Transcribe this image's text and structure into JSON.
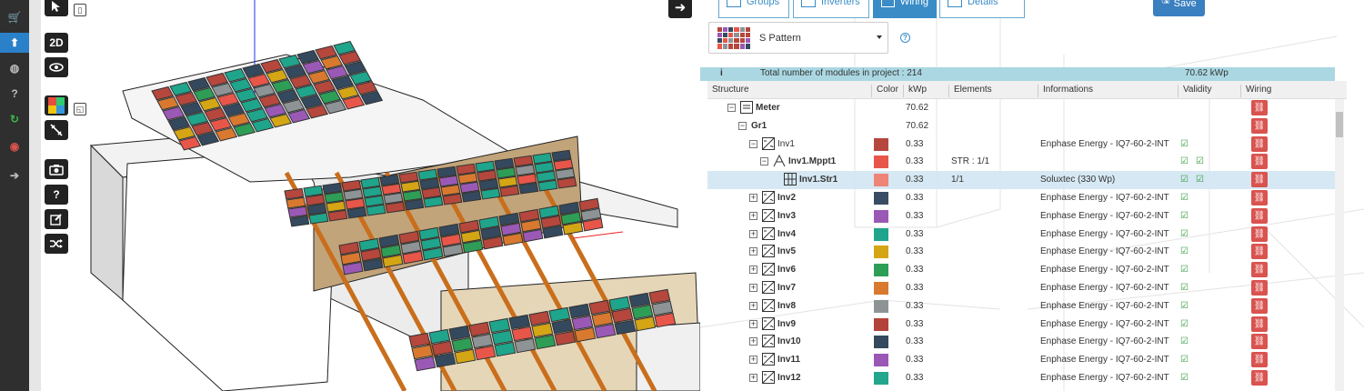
{
  "sidebar": {
    "icons": [
      "cart-icon",
      "upload-icon",
      "globe-icon",
      "help-icon",
      "refresh-icon",
      "sketchup-icon",
      "arrow-right-circle-icon"
    ],
    "active_index": 1
  },
  "viewport": {
    "toolbar": {
      "mode_2d_label": "2D",
      "help_label": "?"
    }
  },
  "panel": {
    "tabs": [
      {
        "label": "Groups",
        "icon": "groups-icon",
        "active": false
      },
      {
        "label": "Inverters",
        "icon": "inverter-icon",
        "active": false
      },
      {
        "label": "Wiring",
        "icon": "wiring-icon",
        "active": true
      },
      {
        "label": "Details",
        "icon": "chart-icon",
        "active": false
      }
    ],
    "save_label": "Save",
    "pattern": {
      "selected": "S Pattern"
    },
    "info": {
      "icon": "i",
      "text": "Total number of modules in project : 214",
      "total_kwp": "70.62 kWp"
    },
    "columns": [
      "Structure",
      "Color",
      "kWp",
      "Elements",
      "Informations",
      "Validity",
      "Wiring"
    ],
    "rows": [
      {
        "level": 1,
        "expander": "⊟",
        "icon": "meter",
        "name": "Meter",
        "color": "",
        "kwp": "70.62",
        "elements": "",
        "info": "",
        "valid": 0,
        "wiring": true,
        "bold": true
      },
      {
        "level": 2,
        "expander": "⊟",
        "icon": "",
        "name": "Gr1",
        "color": "",
        "kwp": "70.62",
        "elements": "",
        "info": "",
        "valid": 0,
        "wiring": true,
        "bold": true
      },
      {
        "level": 3,
        "expander": "⊟",
        "icon": "inverter",
        "name": "Inv1",
        "color": "#b5473d",
        "kwp": "0.33",
        "elements": "",
        "info": "Enphase Energy - IQ7-60-2-INT",
        "valid": 1,
        "wiring": true,
        "bold": false
      },
      {
        "level": 4,
        "expander": "⊟",
        "icon": "mppt",
        "name": "Inv1.Mppt1",
        "color": "#e8564a",
        "kwp": "0.33",
        "elements": "STR : 1/1",
        "info": "",
        "valid": 2,
        "wiring": true,
        "bold": true
      },
      {
        "level": 5,
        "expander": "",
        "icon": "string",
        "name": "Inv1.Str1",
        "color": "#ee8577",
        "kwp": "0.33",
        "elements": "1/1",
        "info": "Soluxtec (330 Wp)",
        "valid": 2,
        "wiring": true,
        "bold": true,
        "selected": true
      },
      {
        "level": 3,
        "expander": "⊞",
        "icon": "inverter",
        "name": "Inv2",
        "color": "#3a4c63",
        "kwp": "0.33",
        "elements": "",
        "info": "Enphase Energy - IQ7-60-2-INT",
        "valid": 1,
        "wiring": true,
        "bold": true
      },
      {
        "level": 3,
        "expander": "⊞",
        "icon": "inverter",
        "name": "Inv3",
        "color": "#9b59b6",
        "kwp": "0.33",
        "elements": "",
        "info": "Enphase Energy - IQ7-60-2-INT",
        "valid": 1,
        "wiring": true,
        "bold": true
      },
      {
        "level": 3,
        "expander": "⊞",
        "icon": "inverter",
        "name": "Inv4",
        "color": "#1fa58c",
        "kwp": "0.33",
        "elements": "",
        "info": "Enphase Energy - IQ7-60-2-INT",
        "valid": 1,
        "wiring": true,
        "bold": true
      },
      {
        "level": 3,
        "expander": "⊞",
        "icon": "inverter",
        "name": "Inv5",
        "color": "#d4a515",
        "kwp": "0.33",
        "elements": "",
        "info": "Enphase Energy - IQ7-60-2-INT",
        "valid": 1,
        "wiring": true,
        "bold": true
      },
      {
        "level": 3,
        "expander": "⊞",
        "icon": "inverter",
        "name": "Inv6",
        "color": "#2e9e57",
        "kwp": "0.33",
        "elements": "",
        "info": "Enphase Energy - IQ7-60-2-INT",
        "valid": 1,
        "wiring": true,
        "bold": true
      },
      {
        "level": 3,
        "expander": "⊞",
        "icon": "inverter",
        "name": "Inv7",
        "color": "#d8792f",
        "kwp": "0.33",
        "elements": "",
        "info": "Enphase Energy - IQ7-60-2-INT",
        "valid": 1,
        "wiring": true,
        "bold": true
      },
      {
        "level": 3,
        "expander": "⊞",
        "icon": "inverter",
        "name": "Inv8",
        "color": "#8e9496",
        "kwp": "0.33",
        "elements": "",
        "info": "Enphase Energy - IQ7-60-2-INT",
        "valid": 1,
        "wiring": true,
        "bold": true
      },
      {
        "level": 3,
        "expander": "⊞",
        "icon": "inverter",
        "name": "Inv9",
        "color": "#b3433a",
        "kwp": "0.33",
        "elements": "",
        "info": "Enphase Energy - IQ7-60-2-INT",
        "valid": 1,
        "wiring": true,
        "bold": true
      },
      {
        "level": 3,
        "expander": "⊞",
        "icon": "inverter",
        "name": "Inv10",
        "color": "#34495e",
        "kwp": "0.33",
        "elements": "",
        "info": "Enphase Energy - IQ7-60-2-INT",
        "valid": 1,
        "wiring": true,
        "bold": true
      },
      {
        "level": 3,
        "expander": "⊞",
        "icon": "inverter",
        "name": "Inv11",
        "color": "#9a57b5",
        "kwp": "0.33",
        "elements": "",
        "info": "Enphase Energy - IQ7-60-2-INT",
        "valid": 1,
        "wiring": true,
        "bold": true
      },
      {
        "level": 3,
        "expander": "⊞",
        "icon": "inverter",
        "name": "Inv12",
        "color": "#22a68c",
        "kwp": "0.33",
        "elements": "",
        "info": "Enphase Energy - IQ7-60-2-INT",
        "valid": 1,
        "wiring": true,
        "bold": true
      }
    ]
  },
  "colors": {
    "accent": "#3a8cc6",
    "info_bar": "#aad7e2",
    "wiring_button": "#d9534f",
    "module_palette": [
      "#b5473d",
      "#9b59b6",
      "#d4a515",
      "#1fa58c",
      "#2e9e57",
      "#d8792f",
      "#34495e",
      "#e8564a",
      "#8e9496"
    ]
  }
}
